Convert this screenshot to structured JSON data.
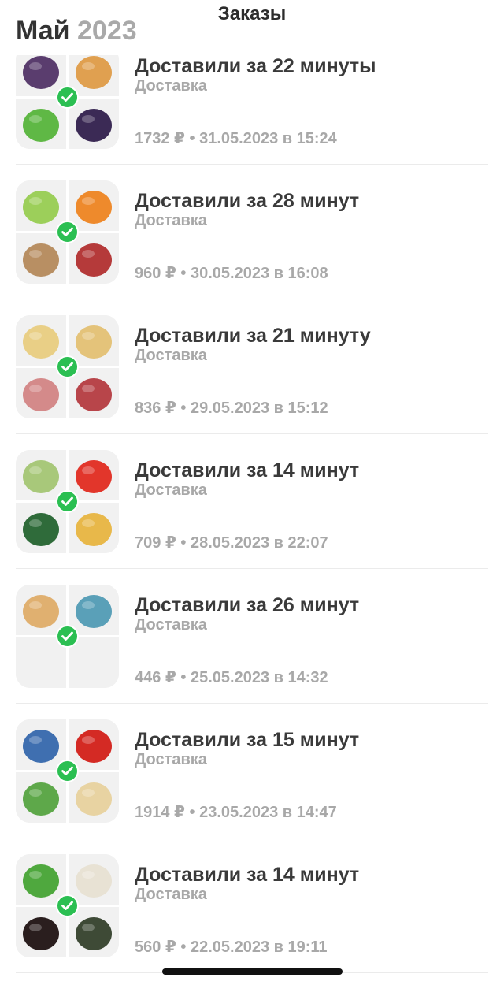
{
  "header": {
    "title": "Заказы",
    "month": "Май",
    "year": "2023"
  },
  "orders": [
    {
      "title": "Доставили за 22 минуты",
      "type": "Доставка",
      "amount": "1732 ₽",
      "date": "31.05.2023 в 15:24",
      "items": [
        {
          "name": "passion-fruit-pack",
          "color": "#5a3d6e"
        },
        {
          "name": "eggs-pack",
          "color": "#e0a050"
        },
        {
          "name": "lettuce",
          "color": "#5fb845"
        },
        {
          "name": "jam-jar",
          "color": "#3b2a55"
        }
      ]
    },
    {
      "title": "Доставили за 28 минут",
      "type": "Доставка",
      "amount": "960 ₽",
      "date": "30.05.2023 в 16:08",
      "items": [
        {
          "name": "celery",
          "color": "#9ccf5a"
        },
        {
          "name": "carrots",
          "color": "#ee8a2c"
        },
        {
          "name": "potatoes",
          "color": "#b88f63"
        },
        {
          "name": "meat-pack",
          "color": "#b53a3a"
        }
      ]
    },
    {
      "title": "Доставили за 21 минуту",
      "type": "Доставка",
      "amount": "836 ₽",
      "date": "29.05.2023 в 15:12",
      "items": [
        {
          "name": "chips-bowl",
          "color": "#e9cf86"
        },
        {
          "name": "chips-bowl-2",
          "color": "#e4c37a"
        },
        {
          "name": "chicken-pack",
          "color": "#d48a8a"
        },
        {
          "name": "meat-pack-2",
          "color": "#b8454a"
        }
      ]
    },
    {
      "title": "Доставили за 14 минут",
      "type": "Доставка",
      "amount": "709 ₽",
      "date": "28.05.2023 в 22:07",
      "items": [
        {
          "name": "chicken-fillet-pack",
          "color": "#a8c87a"
        },
        {
          "name": "tomatoes",
          "color": "#e2362b"
        },
        {
          "name": "spinach-pack",
          "color": "#2f6b3a"
        },
        {
          "name": "crackers",
          "color": "#e8b84a"
        }
      ]
    },
    {
      "title": "Доставили за 26 минут",
      "type": "Доставка",
      "amount": "446 ₽",
      "date": "25.05.2023 в 14:32",
      "items": [
        {
          "name": "chicken-pack-3",
          "color": "#e0b070"
        },
        {
          "name": "chicken-pack-4",
          "color": "#5aa0b8"
        }
      ]
    },
    {
      "title": "Доставили за 15 минут",
      "type": "Доставка",
      "amount": "1914 ₽",
      "date": "23.05.2023 в 14:47",
      "items": [
        {
          "name": "eggs-pack-2",
          "color": "#3f6fb0"
        },
        {
          "name": "red-peppers",
          "color": "#d42a24"
        },
        {
          "name": "green-beans",
          "color": "#5ea84a"
        },
        {
          "name": "oat-pack",
          "color": "#e8d3a2"
        }
      ]
    },
    {
      "title": "Доставили за 14 минут",
      "type": "Доставка",
      "amount": "560 ₽",
      "date": "22.05.2023 в 19:11",
      "items": [
        {
          "name": "greens-bunch",
          "color": "#4fa83e"
        },
        {
          "name": "garlic",
          "color": "#e8e2d4"
        },
        {
          "name": "cola-bottle",
          "color": "#2a1e1e"
        },
        {
          "name": "bread-pack",
          "color": "#3e4a36"
        }
      ]
    }
  ]
}
